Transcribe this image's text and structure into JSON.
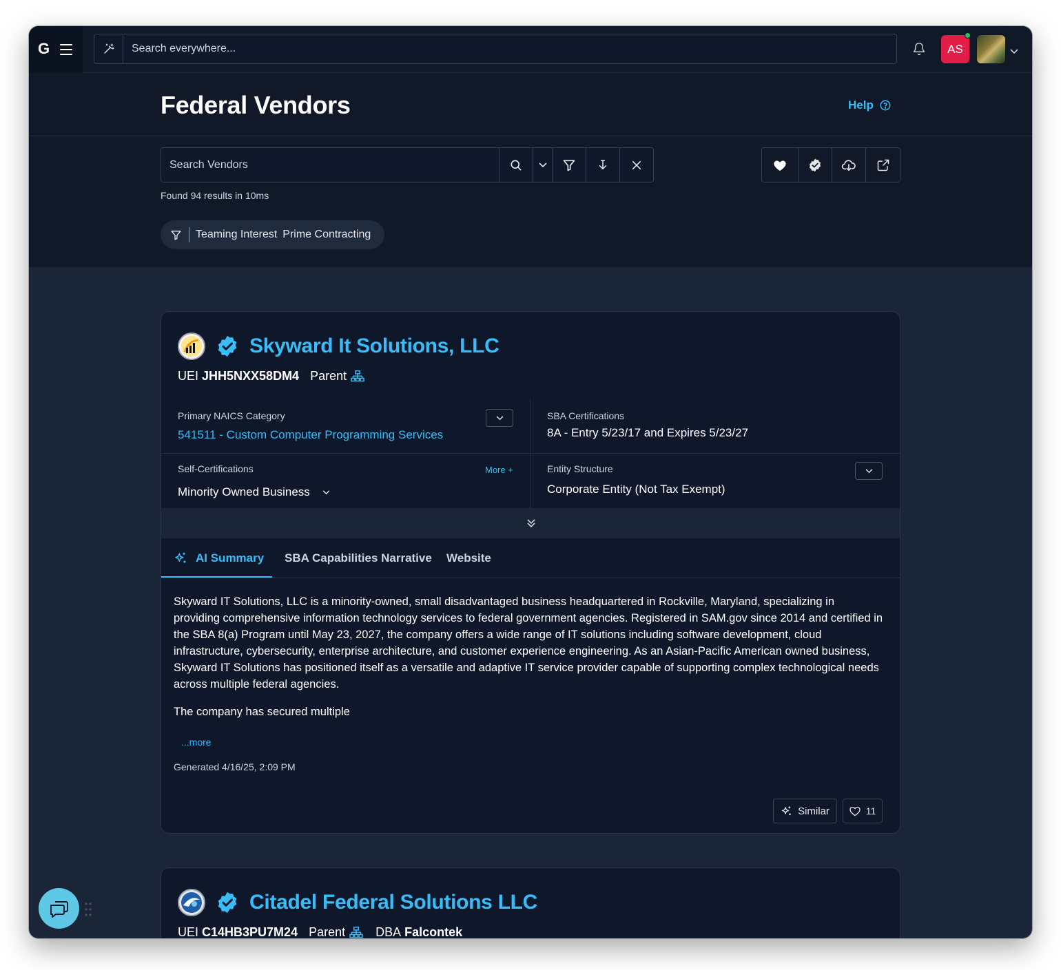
{
  "topbar": {
    "logo": "G",
    "search_placeholder": "Search everywhere...",
    "user_initials": "AS",
    "colors": {
      "avatar_bg": "#e11d48",
      "online": "#22c55e"
    }
  },
  "header": {
    "title": "Federal Vendors",
    "help_label": "Help",
    "search_placeholder": "Search Vendors",
    "results_text": "Found 94 results in 10ms",
    "filter_pill": {
      "field": "Teaming Interest",
      "value": "Prime Contracting"
    }
  },
  "icons": {
    "wand": "magic-wand-icon",
    "bell": "bell-icon",
    "search": "search-icon",
    "filter": "filter-icon",
    "sort": "sort-down-icon",
    "clear": "close-icon",
    "favorite": "heart-icon",
    "verified": "verified-badge-icon",
    "download": "cloud-download-icon",
    "share": "share-icon",
    "hierarchy": "hierarchy-icon",
    "ai": "sparkle-icon",
    "chat": "chat-icon"
  },
  "accent_color": "#38bdf8",
  "vendors": [
    {
      "name": "Skyward It Solutions, LLC",
      "uei_label": "UEI",
      "uei": "JHH5NXX58DM4",
      "parent_label": "Parent",
      "naics_label": "Primary NAICS Category",
      "naics_value": "541511 - Custom Computer Programming Services",
      "sba_label": "SBA Certifications",
      "sba_value": "8A - Entry 5/23/17 and Expires 5/23/27",
      "selfcert_label": "Self-Certifications",
      "selfcert_more": "More +",
      "selfcert_value": "Minority Owned Business",
      "entity_label": "Entity Structure",
      "entity_value": "Corporate Entity (Not Tax Exempt)",
      "tabs": [
        "AI Summary",
        "SBA Capabilities Narrative",
        "Website"
      ],
      "active_tab": "AI Summary",
      "summary_p1": "Skyward IT Solutions, LLC is a minority-owned, small disadvantaged business headquartered in Rockville, Maryland, specializing in providing comprehensive information technology services to federal government agencies. Registered in SAM.gov since 2014 and certified in the SBA 8(a) Program until May 23, 2027, the company offers a wide range of IT solutions including software development, cloud infrastructure, cybersecurity, enterprise architecture, and customer experience engineering. As an Asian-Pacific American owned business, Skyward IT Solutions has positioned itself as a versatile and adaptive IT service provider capable of supporting complex technological needs across multiple federal agencies.",
      "summary_p2": "The company has secured multiple",
      "more_label": "...more",
      "generated": "Generated 4/16/25, 2:09 PM",
      "similar_label": "Similar",
      "likes": "11"
    },
    {
      "name": "Citadel Federal Solutions LLC",
      "uei_label": "UEI",
      "uei": "C14HB3PU7M24",
      "parent_label": "Parent",
      "dba_label": "DBA",
      "dba": "Falcontek"
    }
  ]
}
